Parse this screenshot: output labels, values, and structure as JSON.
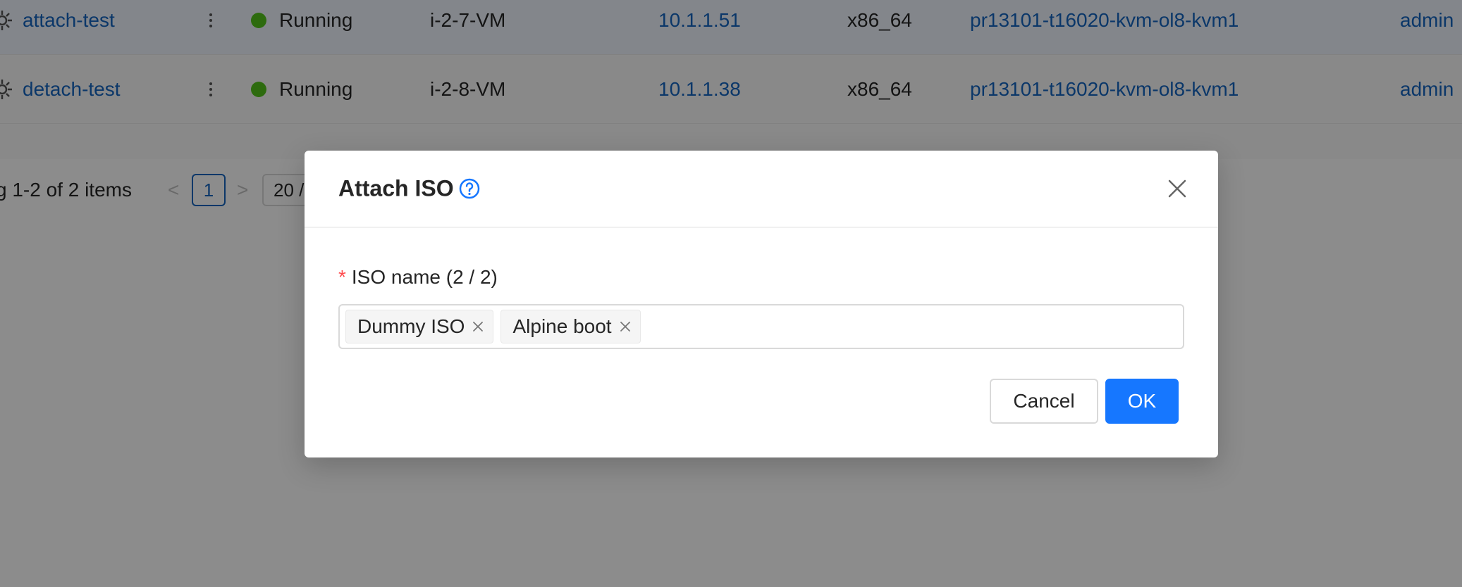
{
  "table": {
    "rows": [
      {
        "name": "attach-test",
        "status": "Running",
        "instance": "i-2-7-VM",
        "ip": "10.1.1.51",
        "arch": "x86_64",
        "host": "pr13101-t16020-kvm-ol8-kvm1",
        "account": "admin"
      },
      {
        "name": "detach-test",
        "status": "Running",
        "instance": "i-2-8-VM",
        "ip": "10.1.1.38",
        "arch": "x86_64",
        "host": "pr13101-t16020-kvm-ol8-kvm1",
        "account": "admin"
      }
    ],
    "status_color": "#52c41a"
  },
  "pagination": {
    "total_text": "g 1-2 of 2 items",
    "prev": "<",
    "current_page": "1",
    "next": ">",
    "page_size": "20 /"
  },
  "modal": {
    "title": "Attach ISO",
    "help_icon": "question-circle-icon",
    "close_icon": "close-icon",
    "field": {
      "required_mark": "*",
      "label": "ISO name (2 / 2)",
      "tags": [
        "Dummy ISO",
        "Alpine boot"
      ]
    },
    "cancel_label": "Cancel",
    "ok_label": "OK",
    "accent_color": "#1677ff"
  }
}
